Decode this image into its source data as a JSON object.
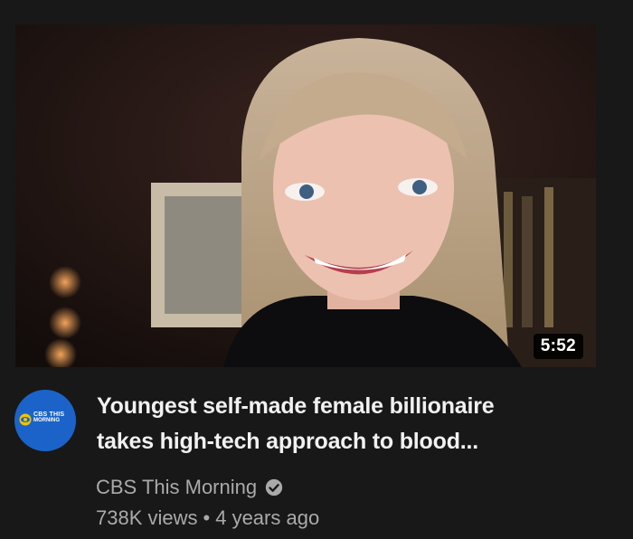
{
  "video": {
    "thumbnail_icon": "interview-still-image",
    "duration": "5:52",
    "title_line1": "Youngest self-made female billionaire",
    "title_line2": "takes high-tech approach to blood...",
    "channel_name": "CBS This Morning",
    "verified_icon": "verified-check-icon",
    "views": "738K views",
    "separator": "•",
    "age": "4 years ago"
  },
  "avatar": {
    "line1": "CBS THIS",
    "line2": "MORNING",
    "background": "#1c63c9"
  },
  "colors": {
    "background": "#181818",
    "title": "#f1f1f1",
    "secondary": "#aaaaaa"
  }
}
